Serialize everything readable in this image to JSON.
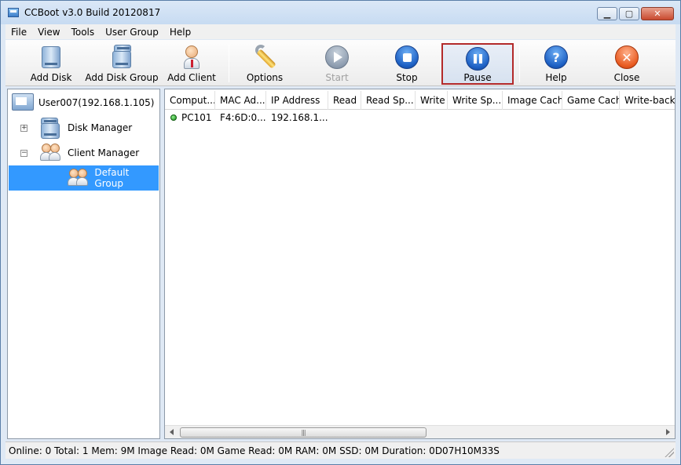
{
  "window": {
    "title": "CCBoot v3.0 Build 20120817"
  },
  "menu": [
    "File",
    "View",
    "Tools",
    "User Group",
    "Help"
  ],
  "toolbar": {
    "add_disk": "Add Disk",
    "add_disk_group": "Add Disk Group",
    "add_client": "Add Client",
    "options": "Options",
    "start": "Start",
    "stop": "Stop",
    "pause": "Pause",
    "help": "Help",
    "close": "Close"
  },
  "tree": {
    "root": "User007(192.168.1.105)",
    "disk_manager": "Disk Manager",
    "client_manager": "Client Manager",
    "default_group": "Default Group"
  },
  "list": {
    "columns": [
      "Comput...",
      "MAC Ad...",
      "IP Address",
      "Read",
      "Read Sp...",
      "Write",
      "Write Sp...",
      "Image Cache",
      "Game Cache",
      "Write-back C"
    ],
    "rows": [
      {
        "computer": "PC101",
        "mac": "F4:6D:0...",
        "ip": "192.168.1...."
      }
    ]
  },
  "statusbar": {
    "text": "Online: 0 Total: 1 Mem: 9M Image Read: 0M Game Read: 0M RAM: 0M SSD: 0M Duration: 0D07H10M33S"
  },
  "colors": {
    "selection": "#3399ff",
    "pressed_border": "#b32a2a",
    "online_dot": "#1c8a1c"
  }
}
